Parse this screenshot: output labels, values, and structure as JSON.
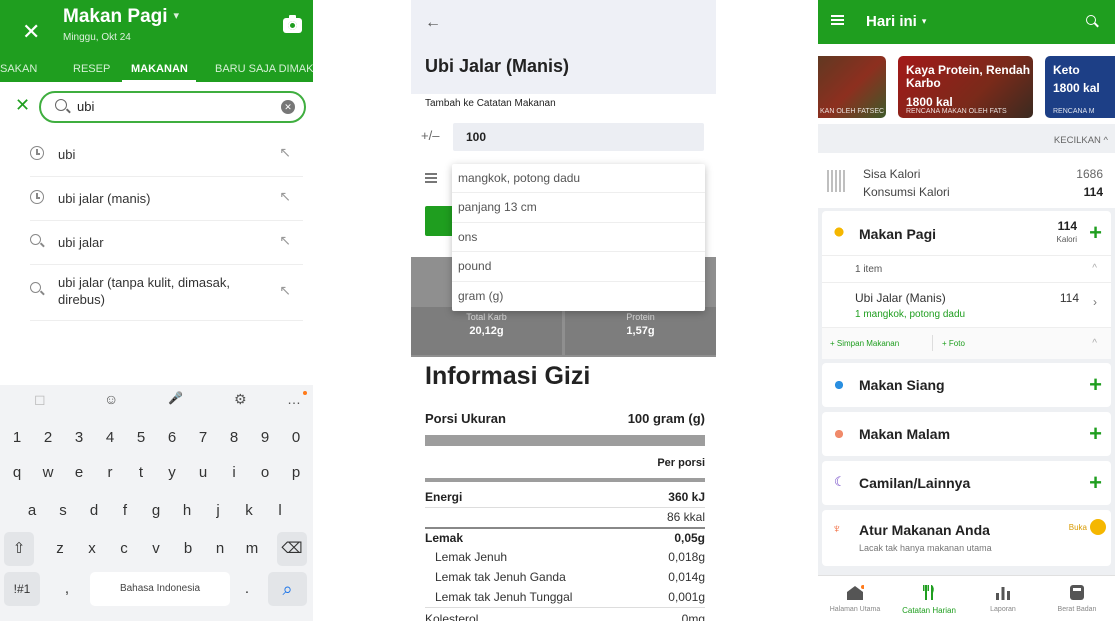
{
  "screen1": {
    "title": "Makan Pagi",
    "title_caret": "▾",
    "subtitle": "Minggu, Okt 24",
    "tabs": [
      {
        "label": "SAKAN"
      },
      {
        "label": "RESEP"
      },
      {
        "label": "MAKANAN"
      },
      {
        "label": "BARU SAJA DIMAK"
      }
    ],
    "search_value": "ubi",
    "results": [
      {
        "text": "ubi",
        "icon": "clock-icon"
      },
      {
        "text": "ubi jalar (manis)",
        "icon": "clock-icon"
      },
      {
        "text": "ubi jalar",
        "icon": "search-icon"
      },
      {
        "text": "ubi jalar (tanpa kulit, dimasak, direbus)",
        "icon": "search-icon"
      }
    ],
    "keyboard": {
      "top_icons": [
        "◻",
        "☺",
        "🎤",
        "⚙",
        "…"
      ],
      "row1": [
        "1",
        "2",
        "3",
        "4",
        "5",
        "6",
        "7",
        "8",
        "9",
        "0"
      ],
      "row2": [
        "q",
        "w",
        "e",
        "r",
        "t",
        "y",
        "u",
        "i",
        "o",
        "p"
      ],
      "row3": [
        "a",
        "s",
        "d",
        "f",
        "g",
        "h",
        "j",
        "k",
        "l"
      ],
      "row4": [
        "z",
        "x",
        "c",
        "v",
        "b",
        "n",
        "m"
      ],
      "shift": "⇧",
      "backspace": "⌫",
      "symbols": "!#1",
      "comma": ",",
      "space": "Bahasa Indonesia",
      "period": ".",
      "search": "⌕"
    }
  },
  "screen2": {
    "back": "←",
    "title": "Ubi Jalar (Manis)",
    "add_label": "Tambah ke Catatan Makanan",
    "plus_minus": "+/–",
    "quantity": "100",
    "unit_options": [
      "mangkok, potong dadu",
      "panjang 13 cm",
      "ons",
      "pound",
      "gram (g)"
    ],
    "macros": [
      {
        "label": "Total Karb",
        "value": "20,12g"
      },
      {
        "label": "Protein",
        "value": "1,57g"
      }
    ],
    "info_title": "Informasi Gizi",
    "porsi_label": "Porsi Ukuran",
    "porsi_value": "100  gram (g)",
    "per_porsi": "Per porsi",
    "energi_label": "Energi",
    "energi_kj": "360 kJ",
    "energi_kkal": "86 kkal",
    "lemak_label": "Lemak",
    "lemak_value": "0,05g",
    "lemak_rows": [
      {
        "label": "Lemak Jenuh",
        "value": "0,018g"
      },
      {
        "label": "Lemak tak Jenuh Ganda",
        "value": "0,014g"
      },
      {
        "label": "Lemak tak Jenuh Tunggal",
        "value": "0,001g"
      }
    ],
    "kolesterol_label": "Kolesterol",
    "kolesterol_value": "0mg"
  },
  "screen3": {
    "title": "Hari ini",
    "title_caret": "▾",
    "banners": [
      {
        "title": "",
        "sub": "KAN OLEH FATSEC",
        "kcal": ""
      },
      {
        "title": "Kaya Protein, Rendah Karbo",
        "sub": "RENCANA MAKAN OLEH FATS",
        "kcal": "1800 kal"
      },
      {
        "title": "Keto",
        "sub": "RENCANA M",
        "kcal": "1800 kal"
      }
    ],
    "kecilkan": "KECILKAN ^",
    "sisa_label": "Sisa Kalori",
    "sisa_value": "1686",
    "konsumsi_label": "Konsumsi Kalori",
    "konsumsi_value": "114",
    "breakfast": {
      "name": "Makan Pagi",
      "kcal": "114",
      "kcal_unit": "Kalori",
      "count": "1 item",
      "item_name": "Ubi Jalar (Manis)",
      "item_kcal": "114",
      "item_portion": "1  mangkok, potong dadu",
      "save": "+ Simpan Makanan",
      "photo": "+ Foto"
    },
    "meals": [
      {
        "name": "Makan Siang"
      },
      {
        "name": "Makan Malam"
      },
      {
        "name": "Camilan/Lainnya"
      }
    ],
    "atur_title": "Atur Makanan Anda",
    "atur_sub": "Lacak tak hanya makanan utama",
    "atur_badge": "Buka",
    "nav": [
      {
        "label": "Halaman Utama"
      },
      {
        "label": "Catatan Harian"
      },
      {
        "label": "Laporan"
      },
      {
        "label": "Berat Badan"
      }
    ],
    "colors": {
      "primary_green": "#1f9e1f",
      "banner_blue": "#1d3f86",
      "accent_orange": "#ff7a1a",
      "sun_yellow": "#f5b700",
      "moon_purple": "#6a3ec4"
    }
  }
}
